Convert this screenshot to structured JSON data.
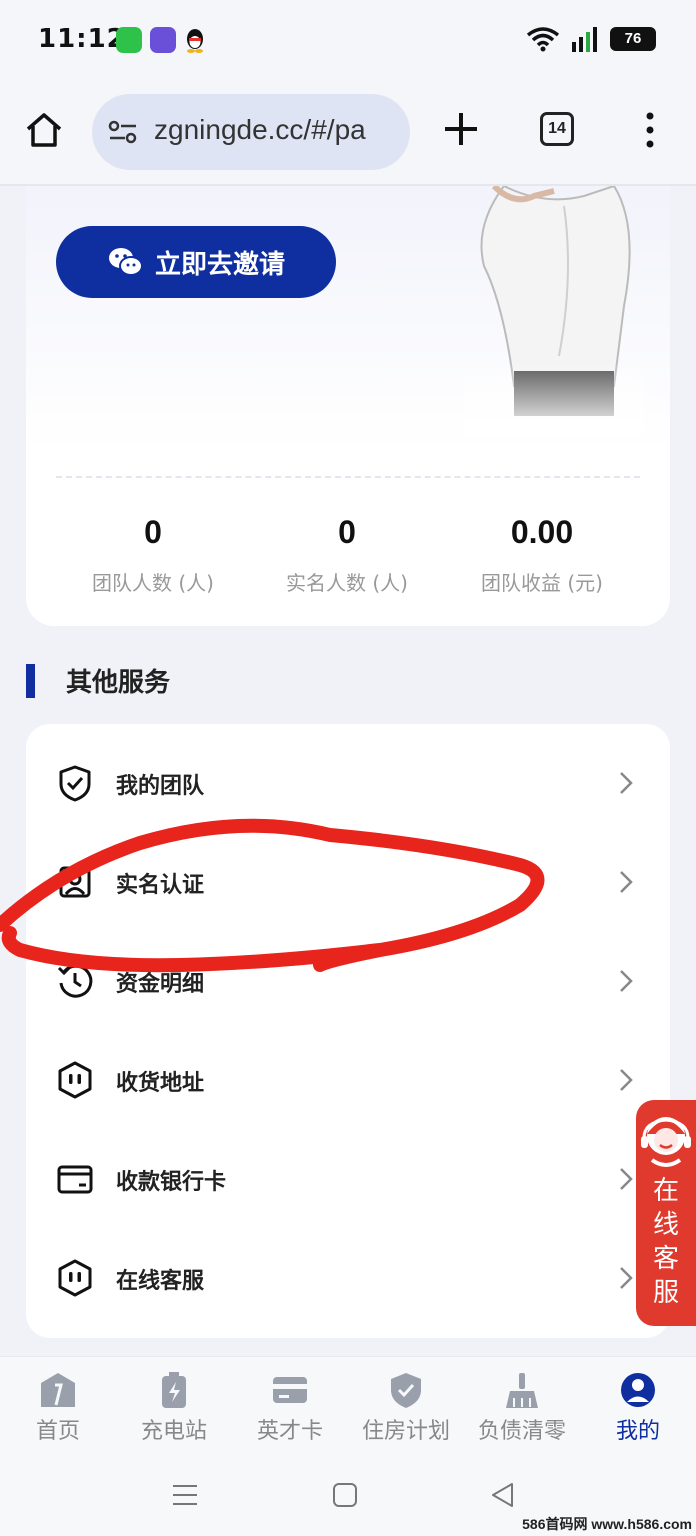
{
  "status_bar": {
    "time": "11:12",
    "battery": "76"
  },
  "browser": {
    "url": "zgningde.cc/#/pa",
    "tab_count": "14"
  },
  "invite": {
    "button_label": "立即去邀请"
  },
  "stats": [
    {
      "value": "0",
      "label": "团队人数 (人)"
    },
    {
      "value": "0",
      "label": "实名人数 (人)"
    },
    {
      "value": "0.00",
      "label": "团队收益 (元)"
    }
  ],
  "section": {
    "title": "其他服务"
  },
  "services": [
    {
      "label": "我的团队",
      "icon": "shield-check-icon"
    },
    {
      "label": "实名认证",
      "icon": "id-card-icon"
    },
    {
      "label": "资金明细",
      "icon": "history-clock-icon"
    },
    {
      "label": "收货地址",
      "icon": "hexagon-face-icon"
    },
    {
      "label": "收款银行卡",
      "icon": "bank-card-icon"
    },
    {
      "label": "在线客服",
      "icon": "hexagon-face-icon"
    }
  ],
  "float_service": {
    "text": "在线客服"
  },
  "bottom_nav": [
    {
      "label": "首页",
      "icon": "home-icon"
    },
    {
      "label": "充电站",
      "icon": "battery-charge-icon"
    },
    {
      "label": "英才卡",
      "icon": "card-icon"
    },
    {
      "label": "住房计划",
      "icon": "shield-icon"
    },
    {
      "label": "负债清零",
      "icon": "broom-icon"
    },
    {
      "label": "我的",
      "icon": "profile-icon",
      "active": true
    }
  ],
  "watermark": "586首码网 www.h586.com",
  "colors": {
    "primary": "#0f2ea0",
    "float_service_bg": "#e03a2f",
    "annotation_red": "#e8251c"
  }
}
